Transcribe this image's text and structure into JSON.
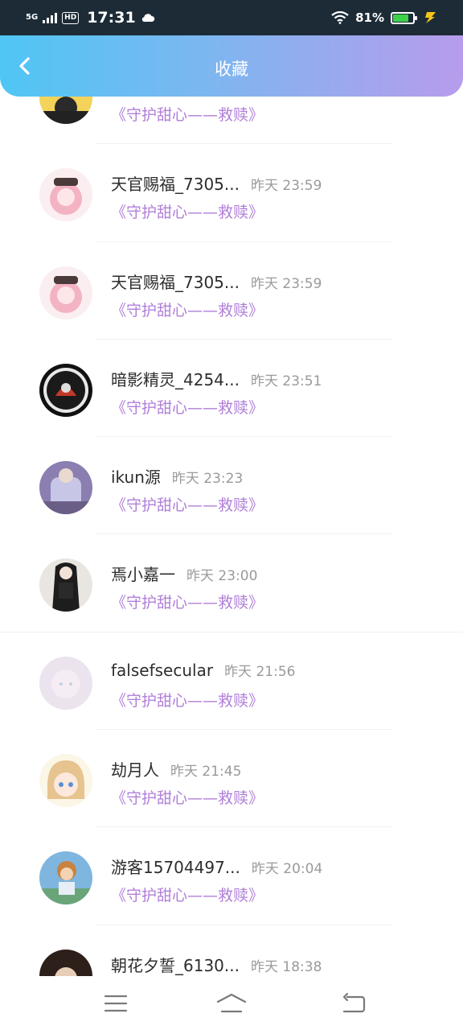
{
  "status_bar": {
    "network": "5G",
    "hd": "HD",
    "time": "17:31",
    "battery_percent": "81%",
    "battery_level": 0.81
  },
  "header": {
    "title": "收藏",
    "back_icon": "chevron-left-icon"
  },
  "colors": {
    "gradient_start": "#4fc6f4",
    "gradient_end": "#b79cec",
    "work_title": "#b07fd9",
    "status_bar": "#1d2b36"
  },
  "items": [
    {
      "name": "",
      "time": "",
      "work": "《守护甜心——救赎》"
    },
    {
      "name": "天官赐福_7305...",
      "time": "昨天 23:59",
      "work": "《守护甜心——救赎》"
    },
    {
      "name": "天官赐福_7305...",
      "time": "昨天 23:59",
      "work": "《守护甜心——救赎》"
    },
    {
      "name": "暗影精灵_4254...",
      "time": "昨天 23:51",
      "work": "《守护甜心——救赎》"
    },
    {
      "name": "ikun源",
      "time": "昨天 23:23",
      "work": "《守护甜心——救赎》"
    },
    {
      "name": "焉小嘉一",
      "time": "昨天 23:00",
      "work": "《守护甜心——救赎》"
    },
    {
      "name": "falsefsecular",
      "time": "昨天 21:56",
      "work": "《守护甜心——救赎》"
    },
    {
      "name": "劫月人",
      "time": "昨天 21:45",
      "work": "《守护甜心——救赎》"
    },
    {
      "name": "游客15704497...",
      "time": "昨天 20:04",
      "work": "《守护甜心——救赎》"
    },
    {
      "name": "朝花夕誓_6130...",
      "time": "昨天 18:38",
      "work": ""
    }
  ],
  "nav": {
    "menu_icon": "menu-icon",
    "home_icon": "home-icon",
    "back_icon": "return-icon"
  }
}
